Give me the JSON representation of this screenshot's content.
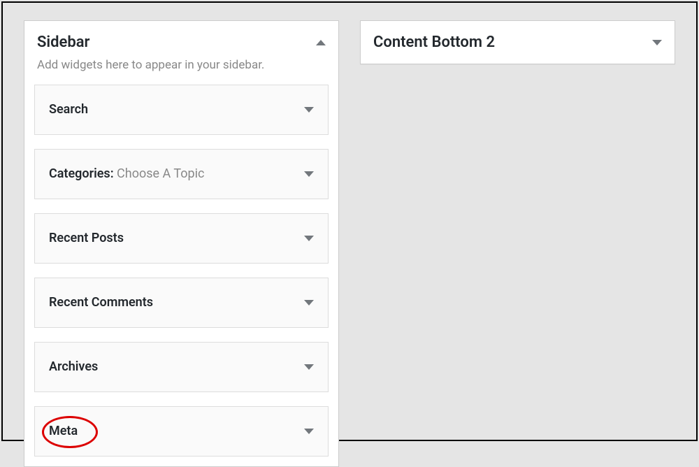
{
  "sidebar_panel": {
    "title": "Sidebar",
    "description": "Add widgets here to appear in your sidebar.",
    "widgets": [
      {
        "label": "Search",
        "suffix": ""
      },
      {
        "label": "Categories:",
        "suffix": " Choose A Topic"
      },
      {
        "label": "Recent Posts",
        "suffix": ""
      },
      {
        "label": "Recent Comments",
        "suffix": ""
      },
      {
        "label": "Archives",
        "suffix": ""
      },
      {
        "label": "Meta",
        "suffix": ""
      }
    ]
  },
  "content_bottom_panel": {
    "title": "Content Bottom 2"
  }
}
